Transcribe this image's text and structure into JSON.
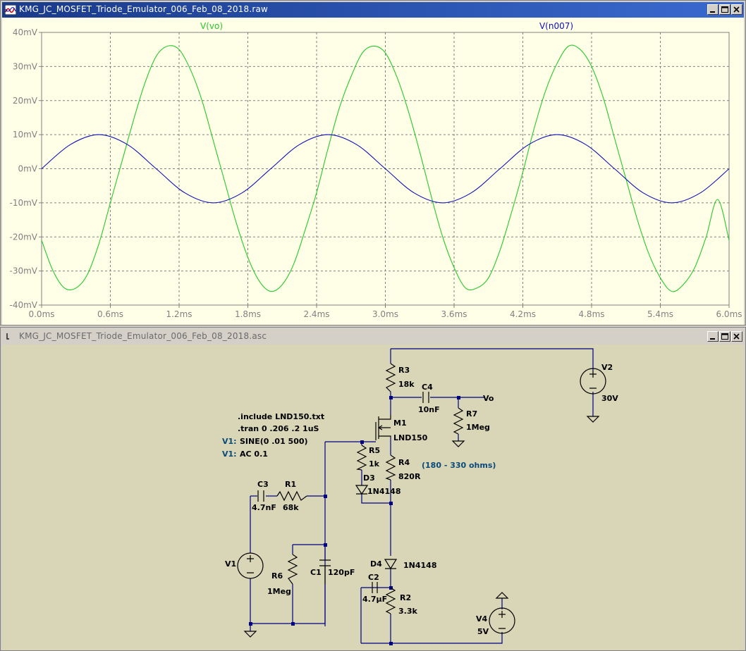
{
  "plot_window": {
    "title": "KMG_JC_MOSFET_Triode_Emulator_006_Feb_08_2018.raw"
  },
  "schematic_window": {
    "title": "KMG_JC_MOSFET_Triode_Emulator_006_Feb_08_2018.asc"
  },
  "colors": {
    "plot_background": "#ffffe8",
    "schematic_background": "#d8d6b6",
    "trace_vo": "#28c828",
    "trace_n007": "#1010b4",
    "axis_text": "#808080",
    "wire": "#000080",
    "directive_blue": "#0a4a7a"
  },
  "chart_data": {
    "type": "line",
    "x_unit": "ms",
    "y_unit": "mV",
    "xlim": [
      0,
      6.0
    ],
    "ylim": [
      -40,
      40
    ],
    "grid": true,
    "x_ticks": [
      "0.0ms",
      "0.6ms",
      "1.2ms",
      "1.8ms",
      "2.4ms",
      "3.0ms",
      "3.6ms",
      "4.2ms",
      "4.8ms",
      "5.4ms",
      "6.0ms"
    ],
    "y_ticks": [
      "40mV",
      "30mV",
      "20mV",
      "10mV",
      "0mV",
      "-10mV",
      "-20mV",
      "-30mV",
      "-40mV"
    ],
    "series": [
      {
        "name": "V(vo)",
        "color": "#28c828",
        "description": "sine, amplitude ~36 mV, 500 Hz, inverted, offset phase",
        "x": [
          0.0,
          0.1,
          0.2,
          0.3,
          0.4,
          0.5,
          0.6,
          0.7,
          0.8,
          0.9,
          1.0,
          1.1,
          1.2,
          1.3,
          1.4,
          1.5,
          1.6,
          1.7,
          1.8,
          1.9,
          2.0,
          2.1,
          2.2,
          2.3,
          2.4,
          2.5,
          2.6,
          2.7,
          2.8,
          2.9,
          3.0,
          3.1,
          3.2,
          3.3,
          3.4,
          3.5,
          3.6,
          3.7,
          3.8,
          3.9,
          4.0,
          4.1,
          4.2,
          4.3,
          4.4,
          4.5,
          4.6,
          4.7,
          4.8,
          4.9,
          5.0,
          5.1,
          5.2,
          5.3,
          5.4,
          5.5,
          5.6,
          5.7,
          5.8,
          5.9,
          6.0
        ],
        "y": [
          -21,
          -30,
          -35,
          -35,
          -31,
          -22,
          -10,
          2,
          14,
          25,
          33,
          36,
          35,
          29,
          20,
          8,
          -4,
          -16,
          -26,
          -33,
          -36,
          -34,
          -28,
          -18,
          -7,
          6,
          18,
          27,
          34,
          36,
          34,
          27,
          17,
          5,
          -8,
          -20,
          -29,
          -35,
          -35,
          -32,
          -24,
          -13,
          -1,
          12,
          23,
          31,
          36,
          35,
          30,
          21,
          9,
          -3,
          -15,
          -25,
          -32,
          -36,
          -34,
          -29,
          -20,
          -9,
          -21
        ]
      },
      {
        "name": "V(n007)",
        "color": "#1010b4",
        "description": "sine, amplitude 10 mV, 500 Hz",
        "x": [
          0.0,
          0.25,
          0.5,
          0.75,
          1.0,
          1.25,
          1.5,
          1.75,
          2.0,
          2.25,
          2.5,
          2.75,
          3.0,
          3.25,
          3.5,
          3.75,
          4.0,
          4.25,
          4.5,
          4.75,
          5.0,
          5.25,
          5.5,
          5.75,
          6.0
        ],
        "y": [
          0,
          7.07,
          10,
          7.07,
          0,
          -7.07,
          -10,
          -7.07,
          0,
          7.07,
          10,
          7.07,
          0,
          -7.07,
          -10,
          -7.07,
          0,
          7.07,
          10,
          7.07,
          0,
          -7.07,
          -10,
          -7.07,
          0
        ]
      }
    ]
  },
  "schematic": {
    "directives": [
      ".include LND150.txt",
      ".tran 0 .206 .2 1uS"
    ],
    "v1_params": [
      {
        "prefix": "V1:",
        "text": "SINE(0 .01 500)"
      },
      {
        "prefix": "V1:",
        "text": "AC 0.1"
      }
    ],
    "note": "(180 - 330 ohms)",
    "components": {
      "R3": {
        "name": "R3",
        "value": "18k"
      },
      "C4": {
        "name": "C4",
        "value": "10nF"
      },
      "net_vo": "Vo",
      "R7": {
        "name": "R7",
        "value": "1Meg"
      },
      "M1": {
        "name": "M1",
        "value": "LND150"
      },
      "R5": {
        "name": "R5",
        "value": "1k"
      },
      "R4": {
        "name": "R4",
        "value": "820R"
      },
      "D3": {
        "name": "D3",
        "value": "1N4148"
      },
      "C3": {
        "name": "C3",
        "value": "4.7nF"
      },
      "R1": {
        "name": "R1",
        "value": "68k"
      },
      "V1": {
        "name": "V1"
      },
      "R6": {
        "name": "R6",
        "value": "1Meg"
      },
      "C1": {
        "name": "C1",
        "value": "120pF"
      },
      "D4": {
        "name": "D4",
        "value": "1N4148"
      },
      "C2": {
        "name": "C2",
        "value": "4.7µF"
      },
      "R2": {
        "name": "R2",
        "value": "3.3k"
      },
      "V2": {
        "name": "V2",
        "value": "30V"
      },
      "V4": {
        "name": "V4",
        "value": "5V"
      }
    }
  }
}
